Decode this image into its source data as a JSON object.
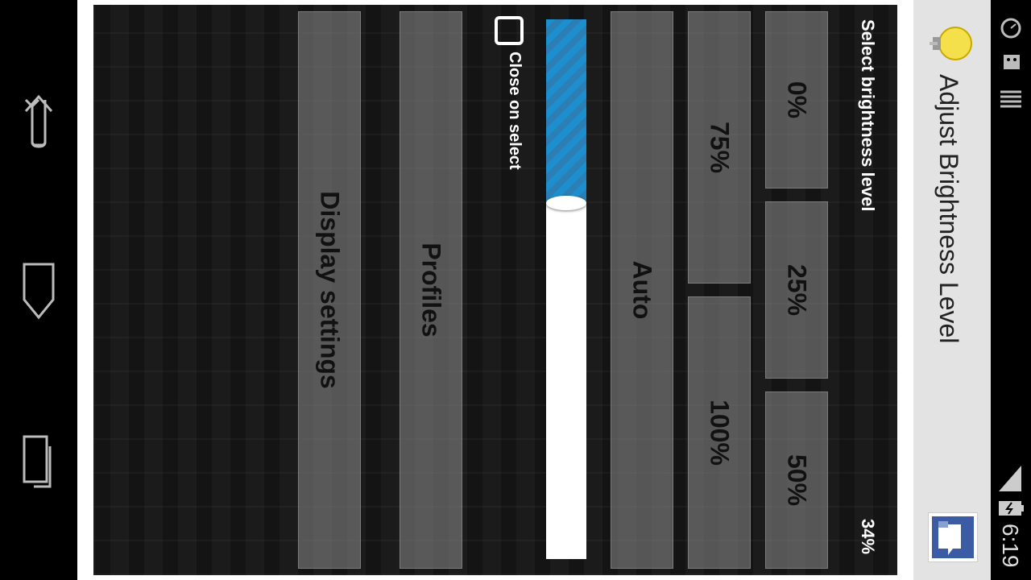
{
  "app": {
    "title": "Adjust Brightness Level"
  },
  "panel": {
    "heading": "Select brightness level",
    "current_value": "34%",
    "presets": [
      "0%",
      "25%",
      "50%",
      "75%",
      "100%"
    ],
    "auto_label": "Auto",
    "close_on_select_label": "Close on select",
    "close_on_select_checked": false,
    "profiles_label": "Profiles",
    "display_settings_label": "Display settings",
    "slider_level_percent": 34
  },
  "statusbar": {
    "time": "6:19"
  },
  "colors": {
    "slider_fill": "#1d8fcf",
    "tile": "#8c8c8c",
    "header_bg": "#e3e3e3"
  },
  "icons": [
    "back-icon",
    "home-icon",
    "recents-icon",
    "lightbulb-icon",
    "thumbs-up-icon",
    "alarm-icon",
    "android-icon",
    "notification-icon",
    "signal-icon",
    "battery-icon"
  ]
}
